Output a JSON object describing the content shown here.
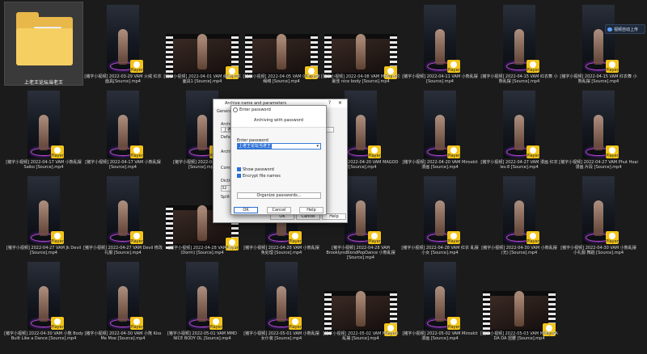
{
  "folder": {
    "label": "上老王论坛当老王"
  },
  "upload_button": {
    "label": "视频自动上传"
  },
  "player_badge": "Player",
  "tiles": [
    {
      "caption": "[猪字小视频] 2022-03-29 VAM 火绒 红衣面具[Source].mp4",
      "kind": "portrait"
    },
    {
      "caption": "[猪字小视频] 2022-04-01 VAM 绳缚 红衣面具1 [Source].mp4",
      "kind": "land"
    },
    {
      "caption": "[猪字小视频] 2022-04-05 VAM 0 可 回旋 绳缚 [Source].mp4",
      "kind": "land"
    },
    {
      "caption": "[猪字小视频] 2022-04-08 VAM MMD 乱伦最佳 nice body [Source].mp4",
      "kind": "land"
    },
    {
      "caption": "[猪字小视频] 2022-04-11 VAM 小熊乱摆 [Source].mp4",
      "kind": "portrait"
    },
    {
      "caption": "[猪字小视频] 2022-04-15 VAM 红衣舞 小熊乱摆 [Source].mp4",
      "kind": "portrait"
    },
    {
      "caption": "[猪字小视频] 2022-04-15 VAM 红衣舞 小熊乱摆 [Source].mp4",
      "kind": "portrait"
    },
    {
      "caption": "[猪字小视频] 2022-04-17 VAM 小熊乱摆 Saiko [Source].mp4",
      "kind": "portrait"
    },
    {
      "caption": "[猪字小视频] 2022-04-17 VAM 小熊乱摆 [Source].mp4",
      "kind": "portrait"
    },
    {
      "caption": "[猪字小视频] 2022-04-19 VAM [Source].mp4",
      "kind": "portrait"
    },
    {
      "caption": "[猪字小视频] 2022-04-20 VAM MAGOO [Source].mp4",
      "kind": "land"
    },
    {
      "caption": "[猪字小视频] 2022-04-20 VAM MAGOO 漫[Source].mp4",
      "kind": "portrait"
    },
    {
      "caption": "[猪字小视频] 2022-04-20 VAM Miroskit 漫画 [Source].mp4",
      "kind": "portrait"
    },
    {
      "caption": "[猪字小视频] 2022-04-27 VAM 漫画 红衣 lev.8 [Source].mp4",
      "kind": "portrait"
    },
    {
      "caption": "[猪字小视频] 2022-04-27 VAM Phut Hoai 漫画 片段 [Source].mp4",
      "kind": "portrait"
    },
    {
      "caption": "[猪字小视频] 2022-04-27 VAM Jk Devil [Source].mp4",
      "kind": "portrait"
    },
    {
      "caption": "[猪字小视频] 2022-04-27 VAM Devil 修改礼服 [Source].mp4",
      "kind": "portrait"
    },
    {
      "caption": "[猪字小视频] 2022-04-28 VAM 黑丝(Dorm) [Source].mp4",
      "kind": "land"
    },
    {
      "caption": "[猪字小视频] 2022-04-28 VAM 小熊乱摆 免处理 [Source].mp4",
      "kind": "portrait"
    },
    {
      "caption": "[猪字小视频] 2022-04-28 VAM BrooklynsBlondPopDance 小熊乱摆 [Source].mp4",
      "kind": "portrait"
    },
    {
      "caption": "[猪字小视频] 2022-04-28 VAM 红衣 乱摆 小女 [Source].mp4",
      "kind": "portrait"
    },
    {
      "caption": "[猪字小视频] 2022-04-30 VAM 小熊乱摆 (无) [Source].mp4",
      "kind": "portrait"
    },
    {
      "caption": "[猪字小视频] 2022-04-30 VAM 小熊乱摆 小礼服 舞蹈 [Source].mp4",
      "kind": "portrait"
    },
    {
      "caption": "[猪字小视频] 2022-04-30 VAM 小熊 Body Built Like a Dance [Source].mp4",
      "kind": "portrait"
    },
    {
      "caption": "[猪字小视频] 2022-04-30 VAM 小熊 Kiss Me Moe [Source].mp4",
      "kind": "portrait"
    },
    {
      "caption": "[猪字小视频] 2022-05-01 VAM MMD NICE BODY OL [Source].mp4",
      "kind": "portrait"
    },
    {
      "caption": "[猪字小视频] 2022-05-01 VAM 小熊乱摆 女仆装 [Source].mp4",
      "kind": "portrait"
    },
    {
      "caption": "[猪字小视频] 2022-05-02 VAM Miroskit 乱摆 [Source].mp4",
      "kind": "land"
    },
    {
      "caption": "[猪字小视频] 2022-05-02 VAM Miroskit 漫画 [Source].mp4",
      "kind": "portrait"
    },
    {
      "caption": "[猪字小视频] 2022-05-03 VAM MMD WA DA DA 扭腰 [Source].mp4",
      "kind": "land"
    }
  ],
  "archive_dialog": {
    "title": "Archive name and parameters",
    "tab_general": "General",
    "archive_label": "Archive",
    "archive_value": "上老王",
    "default_label": "Default",
    "archive_format_label": "Archive",
    "compression_label": "Compression",
    "dictionary_label": "Dictionary",
    "dictionary_value": "32",
    "split_label": "Split to",
    "ok": "OK",
    "cancel": "Cancel",
    "help": "Help"
  },
  "password_dialog": {
    "title": "Enter password",
    "header": "Archiving with password",
    "enter_password_label": "Enter password",
    "password_value": "上老王论坛当老王",
    "show_password": "Show password",
    "encrypt_names": "Encrypt file names",
    "organize_button": "Organize passwords...",
    "ok": "OK",
    "cancel": "Cancel",
    "help": "Help"
  }
}
